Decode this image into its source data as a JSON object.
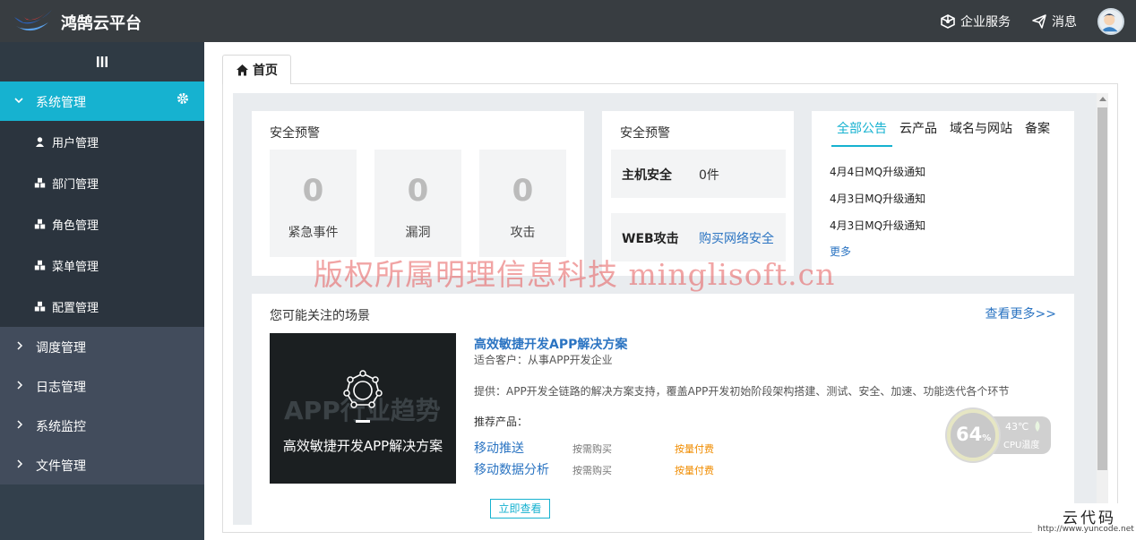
{
  "header": {
    "brand": "鸿鹄云平台",
    "links": [
      {
        "label": "企业服务",
        "icon": "cube-icon"
      },
      {
        "label": "消息",
        "icon": "paper-plane-icon"
      }
    ],
    "avatar": "user-avatar"
  },
  "sidebar": {
    "toggle_icon": "bars-icon",
    "open_group": {
      "label": "系统管理",
      "icon": "chevron-down-icon",
      "action_icon": "gear-icon"
    },
    "sub_items": [
      {
        "label": "用户管理",
        "icon": "user-icon"
      },
      {
        "label": "部门管理",
        "icon": "cubes-icon"
      },
      {
        "label": "角色管理",
        "icon": "cubes-icon"
      },
      {
        "label": "菜单管理",
        "icon": "cubes-icon"
      },
      {
        "label": "配置管理",
        "icon": "cubes-icon"
      }
    ],
    "groups": [
      {
        "label": "调度管理"
      },
      {
        "label": "日志管理"
      },
      {
        "label": "系统监控"
      },
      {
        "label": "文件管理"
      }
    ]
  },
  "tabs": [
    {
      "label": "首页",
      "icon": "home-icon",
      "active": true
    }
  ],
  "security_card": {
    "title": "安全预警",
    "stats": [
      {
        "value": "0",
        "label": "紧急事件"
      },
      {
        "value": "0",
        "label": "漏洞"
      },
      {
        "value": "0",
        "label": "攻击"
      }
    ]
  },
  "security_card2": {
    "title": "安全预警",
    "rows": [
      {
        "key": "主机安全",
        "value": "0件"
      },
      {
        "key": "WEB攻击",
        "value": "购买网络安全"
      }
    ]
  },
  "notices": {
    "tabs": [
      "全部公告",
      "云产品",
      "域名与网站",
      "备案"
    ],
    "active_tab": "全部公告",
    "items": [
      "4月4日MQ升级通知",
      "4月3日MQ升级通知",
      "4月3日MQ升级通知"
    ],
    "more": "更多"
  },
  "watermark": "版权所属明理信息科技 minglisoft.cn",
  "scenes": {
    "title": "您可能关注的场景",
    "more": "查看更多>>",
    "banner": {
      "bg_text": "APP行业趋势",
      "caption": "高效敏捷开发APP解决方案"
    },
    "solution": {
      "title": "高效敏捷开发APP解决方案",
      "client": "适合客户：从事APP开发企业",
      "desc": "提供：APP开发全链路的解决方案支持，覆盖APP开发初始阶段架构搭建、测试、安全、加速、功能迭代各个环节",
      "recommend": "推荐产品：",
      "products": [
        {
          "name": "移动推送",
          "tag": "按需购买",
          "price": "按量付费"
        },
        {
          "name": "移动数据分析",
          "tag": "按需购买",
          "price": "按量付费"
        }
      ],
      "button": "立即查看"
    }
  },
  "cpu_widget": {
    "percent": "64",
    "percent_unit": "%",
    "temp": "43℃",
    "label": "CPU温度"
  },
  "corner_watermark": {
    "text": "云代码",
    "url": "http://www.yuncode.net"
  },
  "colors": {
    "accent": "#16b2d0",
    "topbar": "#383d41",
    "sidebar": "#33404c",
    "link": "#2b74c2",
    "price": "#f08c00"
  }
}
